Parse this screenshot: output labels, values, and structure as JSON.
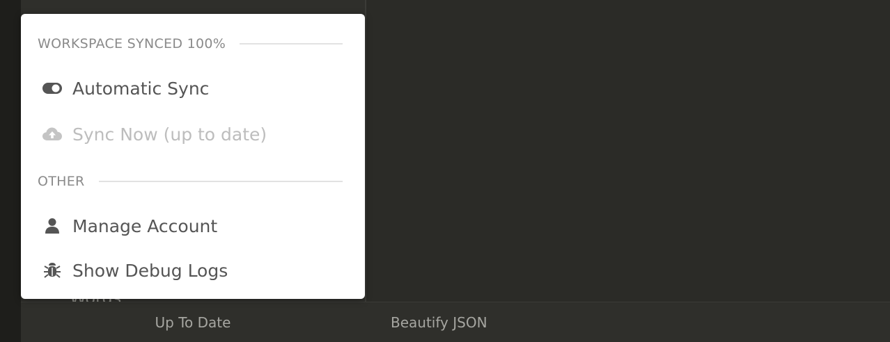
{
  "menu": {
    "section_sync": "WORKSPACE SYNCED 100%",
    "automatic_sync": "Automatic Sync",
    "sync_now": "Sync Now (up to date)",
    "section_other": "OTHER",
    "manage_account": "Manage Account",
    "debug_logs": "Show Debug Logs"
  },
  "sidebar": {
    "partial_item": "Words"
  },
  "footer": {
    "sync_status": "Up To Date",
    "right_label": "Beautify JSON"
  },
  "icons": {
    "automatic_sync": "toggle-on-icon",
    "sync_now": "cloud-upload-icon",
    "manage_account": "user-icon",
    "debug_logs": "bug-icon"
  },
  "colors": {
    "background": "#2b2b27",
    "menu_bg": "#ffffff",
    "text": "#555555",
    "disabled_text": "#bdbdbd",
    "section_text": "#8a8a8a"
  }
}
